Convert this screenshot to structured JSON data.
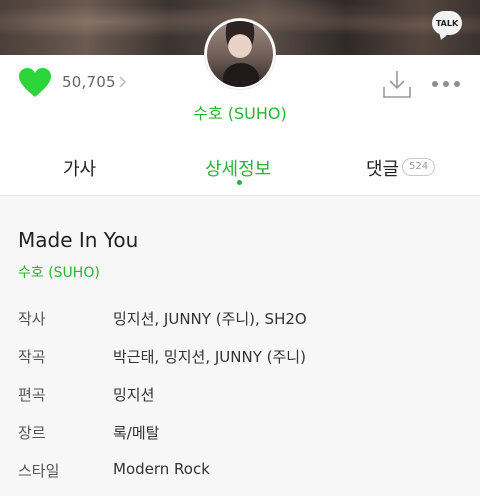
{
  "header": {
    "talk_badge": "TALK",
    "like_count": "50,705",
    "artist_name": "수호 (SUHO)"
  },
  "icons": {
    "like": "heart-icon",
    "chevron": "chevron-right-icon",
    "download": "download-icon",
    "more": "more-icon",
    "talk": "talk-bubble-icon"
  },
  "tabs": [
    {
      "label": "가사"
    },
    {
      "label": "상세정보"
    },
    {
      "label": "댓글",
      "badge": "524"
    }
  ],
  "song": {
    "title": "Made In You",
    "artist": "수호 (SUHO)"
  },
  "info": [
    {
      "label": "작사",
      "value": "밍지션, JUNNY (주니), SH2O"
    },
    {
      "label": "작곡",
      "value": "박근태, 밍지션, JUNNY (주니)"
    },
    {
      "label": "편곡",
      "value": "밍지션"
    },
    {
      "label": "장르",
      "value": "록/메탈"
    },
    {
      "label": "스타일",
      "value": "Modern Rock"
    }
  ],
  "colors": {
    "accent": "#28b436",
    "heart": "#2dd43a",
    "detail_bg": "#f7f7f7"
  }
}
